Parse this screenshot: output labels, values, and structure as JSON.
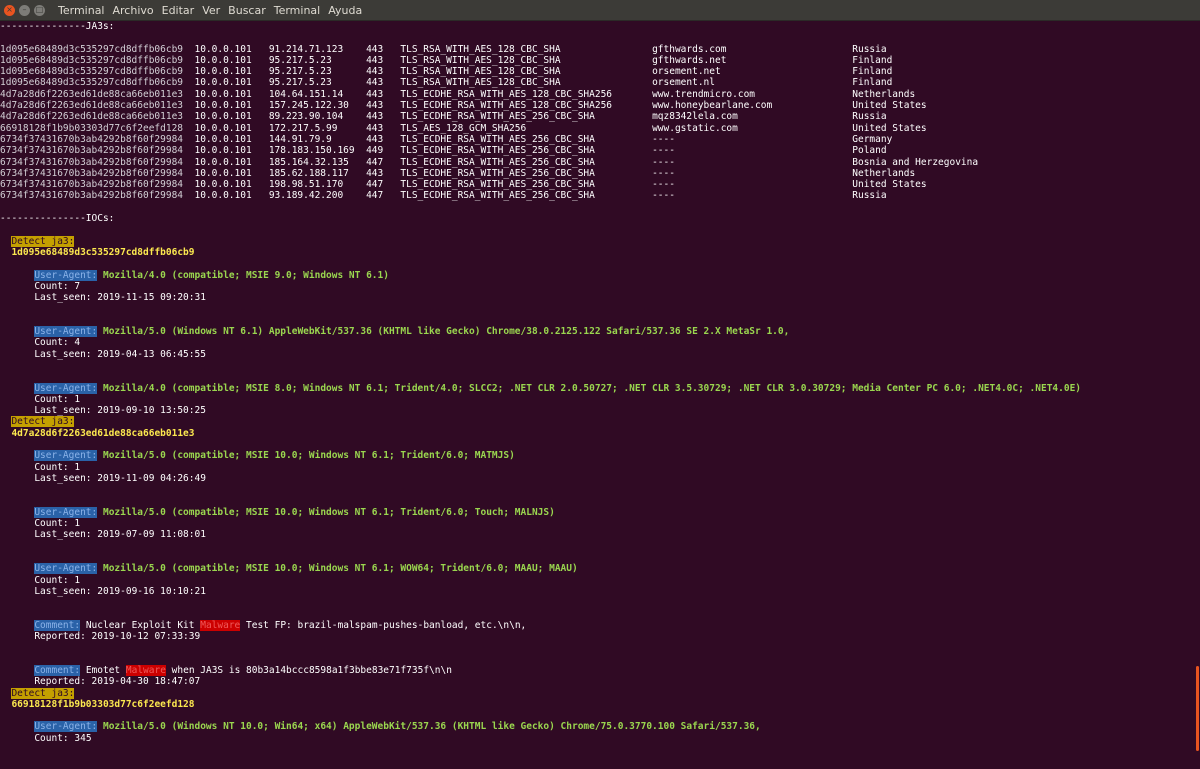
{
  "window": {
    "menu": [
      "Terminal",
      "Archivo",
      "Editar",
      "Ver",
      "Buscar",
      "Terminal",
      "Ayuda"
    ],
    "close_glyph": "×",
    "min_glyph": "–",
    "max_glyph": "□"
  },
  "ja3s_header": "---------------JA3s:",
  "ja3s_rows": [
    {
      "hash": "1d095e68489d3c535297cd8dffb06cb9",
      "src": "10.0.0.101",
      "dst": "91.214.71.123",
      "port": "443",
      "cipher": "TLS_RSA_WITH_AES_128_CBC_SHA",
      "domain": "gfthwards.com",
      "country": "Russia"
    },
    {
      "hash": "1d095e68489d3c535297cd8dffb06cb9",
      "src": "10.0.0.101",
      "dst": "95.217.5.23",
      "port": "443",
      "cipher": "TLS_RSA_WITH_AES_128_CBC_SHA",
      "domain": "gfthwards.net",
      "country": "Finland"
    },
    {
      "hash": "1d095e68489d3c535297cd8dffb06cb9",
      "src": "10.0.0.101",
      "dst": "95.217.5.23",
      "port": "443",
      "cipher": "TLS_RSA_WITH_AES_128_CBC_SHA",
      "domain": "orsement.net",
      "country": "Finland"
    },
    {
      "hash": "1d095e68489d3c535297cd8dffb06cb9",
      "src": "10.0.0.101",
      "dst": "95.217.5.23",
      "port": "443",
      "cipher": "TLS_RSA_WITH_AES_128_CBC_SHA",
      "domain": "orsement.nl",
      "country": "Finland"
    },
    {
      "hash": "4d7a28d6f2263ed61de88ca66eb011e3",
      "src": "10.0.0.101",
      "dst": "104.64.151.14",
      "port": "443",
      "cipher": "TLS_ECDHE_RSA_WITH_AES_128_CBC_SHA256",
      "domain": "www.trendmicro.com",
      "country": "Netherlands"
    },
    {
      "hash": "4d7a28d6f2263ed61de88ca66eb011e3",
      "src": "10.0.0.101",
      "dst": "157.245.122.30",
      "port": "443",
      "cipher": "TLS_ECDHE_RSA_WITH_AES_128_CBC_SHA256",
      "domain": "www.honeybearlane.com",
      "country": "United States"
    },
    {
      "hash": "4d7a28d6f2263ed61de88ca66eb011e3",
      "src": "10.0.0.101",
      "dst": "89.223.90.104",
      "port": "443",
      "cipher": "TLS_ECDHE_RSA_WITH_AES_256_CBC_SHA",
      "domain": "mqz8342lela.com",
      "country": "Russia"
    },
    {
      "hash": "66918128f1b9b03303d77c6f2eefd128",
      "src": "10.0.0.101",
      "dst": "172.217.5.99",
      "port": "443",
      "cipher": "TLS_AES_128_GCM_SHA256",
      "domain": "www.gstatic.com",
      "country": "United States"
    },
    {
      "hash": "6734f37431670b3ab4292b8f60f29984",
      "src": "10.0.0.101",
      "dst": "144.91.79.9",
      "port": "443",
      "cipher": "TLS_ECDHE_RSA_WITH_AES_256_CBC_SHA",
      "domain": "----",
      "country": "Germany"
    },
    {
      "hash": "6734f37431670b3ab4292b8f60f29984",
      "src": "10.0.0.101",
      "dst": "178.183.150.169",
      "port": "449",
      "cipher": "TLS_ECDHE_RSA_WITH_AES_256_CBC_SHA",
      "domain": "----",
      "country": "Poland"
    },
    {
      "hash": "6734f37431670b3ab4292b8f60f29984",
      "src": "10.0.0.101",
      "dst": "185.164.32.135",
      "port": "447",
      "cipher": "TLS_ECDHE_RSA_WITH_AES_256_CBC_SHA",
      "domain": "----",
      "country": "Bosnia and Herzegovina"
    },
    {
      "hash": "6734f37431670b3ab4292b8f60f29984",
      "src": "10.0.0.101",
      "dst": "185.62.188.117",
      "port": "443",
      "cipher": "TLS_ECDHE_RSA_WITH_AES_256_CBC_SHA",
      "domain": "----",
      "country": "Netherlands"
    },
    {
      "hash": "6734f37431670b3ab4292b8f60f29984",
      "src": "10.0.0.101",
      "dst": "198.98.51.170",
      "port": "447",
      "cipher": "TLS_ECDHE_RSA_WITH_AES_256_CBC_SHA",
      "domain": "----",
      "country": "United States"
    },
    {
      "hash": "6734f37431670b3ab4292b8f60f29984",
      "src": "10.0.0.101",
      "dst": "93.189.42.200",
      "port": "447",
      "cipher": "TLS_ECDHE_RSA_WITH_AES_256_CBC_SHA",
      "domain": "----",
      "country": "Russia"
    }
  ],
  "iocs_header": "---------------IOCs:",
  "labels": {
    "detect": "Detect ja3:",
    "user_agent": "User-Agent:",
    "comment": "Comment:",
    "count": "Count:",
    "last_seen": "Last_seen:",
    "reported": "Reported:"
  },
  "ioc_groups": [
    {
      "hash": "1d095e68489d3c535297cd8dffb06cb9",
      "entries": [
        {
          "kind": "ua",
          "value": "Mozilla/4.0 (compatible; MSIE 9.0; Windows NT 6.1)",
          "count": "7",
          "last_seen": "2019-11-15 09:20:31"
        },
        {
          "kind": "ua",
          "value": "Mozilla/5.0 (Windows NT 6.1) AppleWebKit/537.36 (KHTML like Gecko) Chrome/38.0.2125.122 Safari/537.36 SE 2.X MetaSr 1.0,",
          "count": "4",
          "last_seen": "2019-04-13 06:45:55"
        },
        {
          "kind": "ua",
          "value": "Mozilla/4.0 (compatible; MSIE 8.0; Windows NT 6.1; Trident/4.0; SLCC2; .NET CLR 2.0.50727; .NET CLR 3.5.30729; .NET CLR 3.0.30729; Media Center PC 6.0; .NET4.0C; .NET4.0E)",
          "count": "1",
          "last_seen": "2019-09-10 13:50:25"
        }
      ]
    },
    {
      "hash": "4d7a28d6f2263ed61de88ca66eb011e3",
      "entries": [
        {
          "kind": "ua",
          "value": "Mozilla/5.0 (compatible; MSIE 10.0; Windows NT 6.1; Trident/6.0; MATMJS)",
          "count": "1",
          "last_seen": "2019-11-09 04:26:49"
        },
        {
          "kind": "ua",
          "value": "Mozilla/5.0 (compatible; MSIE 10.0; Windows NT 6.1; Trident/6.0; Touch; MALNJS)",
          "count": "1",
          "last_seen": "2019-07-09 11:08:01"
        },
        {
          "kind": "ua",
          "value": "Mozilla/5.0 (compatible; MSIE 10.0; Windows NT 6.1; WOW64; Trident/6.0; MAAU; MAAU)",
          "count": "1",
          "last_seen": "2019-09-16 10:10:21"
        },
        {
          "kind": "comment",
          "before": "Nuclear Exploit Kit",
          "highlight": "Malware",
          "after": "Test FP: brazil-malspam-pushes-banload, etc.\\n\\n,",
          "reported": "2019-10-12 07:33:39"
        },
        {
          "kind": "comment",
          "before": "Emotet",
          "highlight": "Malware",
          "after": "when JA3S is 80b3a14bccc8598a1f3bbe83e71f735f\\n\\n",
          "reported": "2019-04-30 18:47:07"
        }
      ]
    },
    {
      "hash": "66918128f1b9b03303d77c6f2eefd128",
      "entries": [
        {
          "kind": "ua",
          "value": "Mozilla/5.0 (Windows NT 10.0; Win64; x64) AppleWebKit/537.36 (KHTML like Gecko) Chrome/75.0.3770.100 Safari/537.36,",
          "count": "345",
          "last_seen": ""
        }
      ]
    }
  ],
  "colors": {
    "background": "#300a24",
    "menubar": "#3c3b37",
    "green": "#9ad64f",
    "yellow": "#fce94f",
    "ua_label_bg": "#2a62a8",
    "malware_bg": "#cc0000",
    "scroll_accent": "#e95420"
  }
}
